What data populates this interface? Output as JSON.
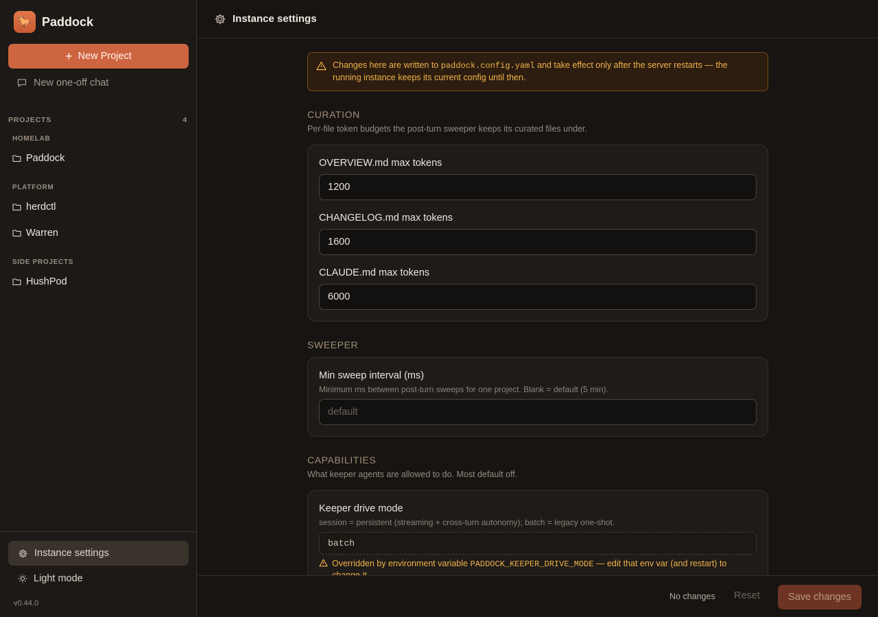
{
  "brand": {
    "name": "Paddock",
    "logo_glyph": "🐎"
  },
  "sidebar": {
    "new_project_label": "New Project",
    "new_chat_label": "New one-off chat",
    "projects_heading": "PROJECTS",
    "projects_count": "4",
    "groups": [
      {
        "heading": "HOMELAB",
        "items": [
          "Paddock"
        ]
      },
      {
        "heading": "PLATFORM",
        "items": [
          "herdctl",
          "Warren"
        ]
      },
      {
        "heading": "SIDE PROJECTS",
        "items": [
          "HushPod"
        ]
      }
    ],
    "instance_settings_label": "Instance settings",
    "light_mode_label": "Light mode",
    "version": "v0.44.0"
  },
  "topbar": {
    "title": "Instance settings"
  },
  "notice": {
    "before": "Changes here are written to ",
    "file": "paddock.config.yaml",
    "after": " and take effect only after the server restarts — the running instance keeps its current config until then."
  },
  "curation": {
    "title": "CURATION",
    "description": "Per-file token budgets the post-turn sweeper keeps its curated files under.",
    "fields": [
      {
        "label": "OVERVIEW.md max tokens",
        "value": "1200"
      },
      {
        "label": "CHANGELOG.md max tokens",
        "value": "1600"
      },
      {
        "label": "CLAUDE.md max tokens",
        "value": "6000"
      }
    ]
  },
  "sweeper": {
    "title": "SWEEPER",
    "field_label": "Min sweep interval (ms)",
    "field_help": "Minimum ms between post-turn sweeps for one project. Blank = default (5 min).",
    "placeholder": "default"
  },
  "capabilities": {
    "title": "CAPABILITIES",
    "description": "What keeper agents are allowed to do. Most default off.",
    "field_label": "Keeper drive mode",
    "field_help": "session = persistent (streaming + cross-turn autonomy); batch = legacy one-shot.",
    "value": "batch",
    "override_before": "Overridden by environment variable ",
    "override_var": "PADDOCK_KEEPER_DRIVE_MODE",
    "override_after": " — edit that env var (and restart) to change it."
  },
  "footer": {
    "status": "No changes",
    "reset_label": "Reset",
    "save_label": "Save changes"
  },
  "colors": {
    "accent": "#cd6540",
    "warning": "#f0b24a",
    "background": "#171411"
  }
}
